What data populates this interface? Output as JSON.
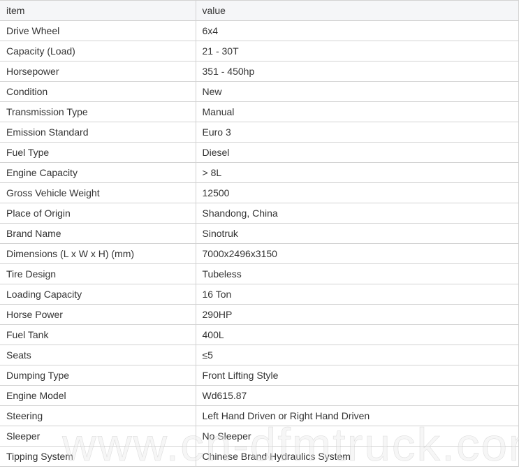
{
  "table": {
    "headers": [
      "item",
      "value"
    ],
    "rows": [
      [
        "Drive Wheel",
        "6x4"
      ],
      [
        "Capacity (Load)",
        "21 - 30T"
      ],
      [
        "Horsepower",
        "351 - 450hp"
      ],
      [
        "Condition",
        "New"
      ],
      [
        "Transmission Type",
        "Manual"
      ],
      [
        "Emission Standard",
        "Euro 3"
      ],
      [
        "Fuel Type",
        "Diesel"
      ],
      [
        "Engine Capacity",
        "> 8L"
      ],
      [
        "Gross Vehicle Weight",
        "12500"
      ],
      [
        "Place of Origin",
        "Shandong, China"
      ],
      [
        "Brand Name",
        "Sinotruk"
      ],
      [
        "Dimensions (L x W x H) (mm)",
        "7000x2496x3150"
      ],
      [
        "Tire Design",
        "Tubeless"
      ],
      [
        "Loading Capacity",
        "16 Ton"
      ],
      [
        "Horse Power",
        "290HP"
      ],
      [
        "Fuel Tank",
        "400L"
      ],
      [
        "Seats",
        "≤5"
      ],
      [
        "Dumping Type",
        "Front Lifting Style"
      ],
      [
        "Engine Model",
        "Wd615.87"
      ],
      [
        "Steering",
        "Left Hand Driven or Right Hand Driven"
      ],
      [
        "Sleeper",
        "No Sleeper"
      ],
      [
        "Tipping System",
        "Chinese Brand Hydraulics System"
      ]
    ]
  },
  "watermark": "www.cn-dfmtruck.com"
}
